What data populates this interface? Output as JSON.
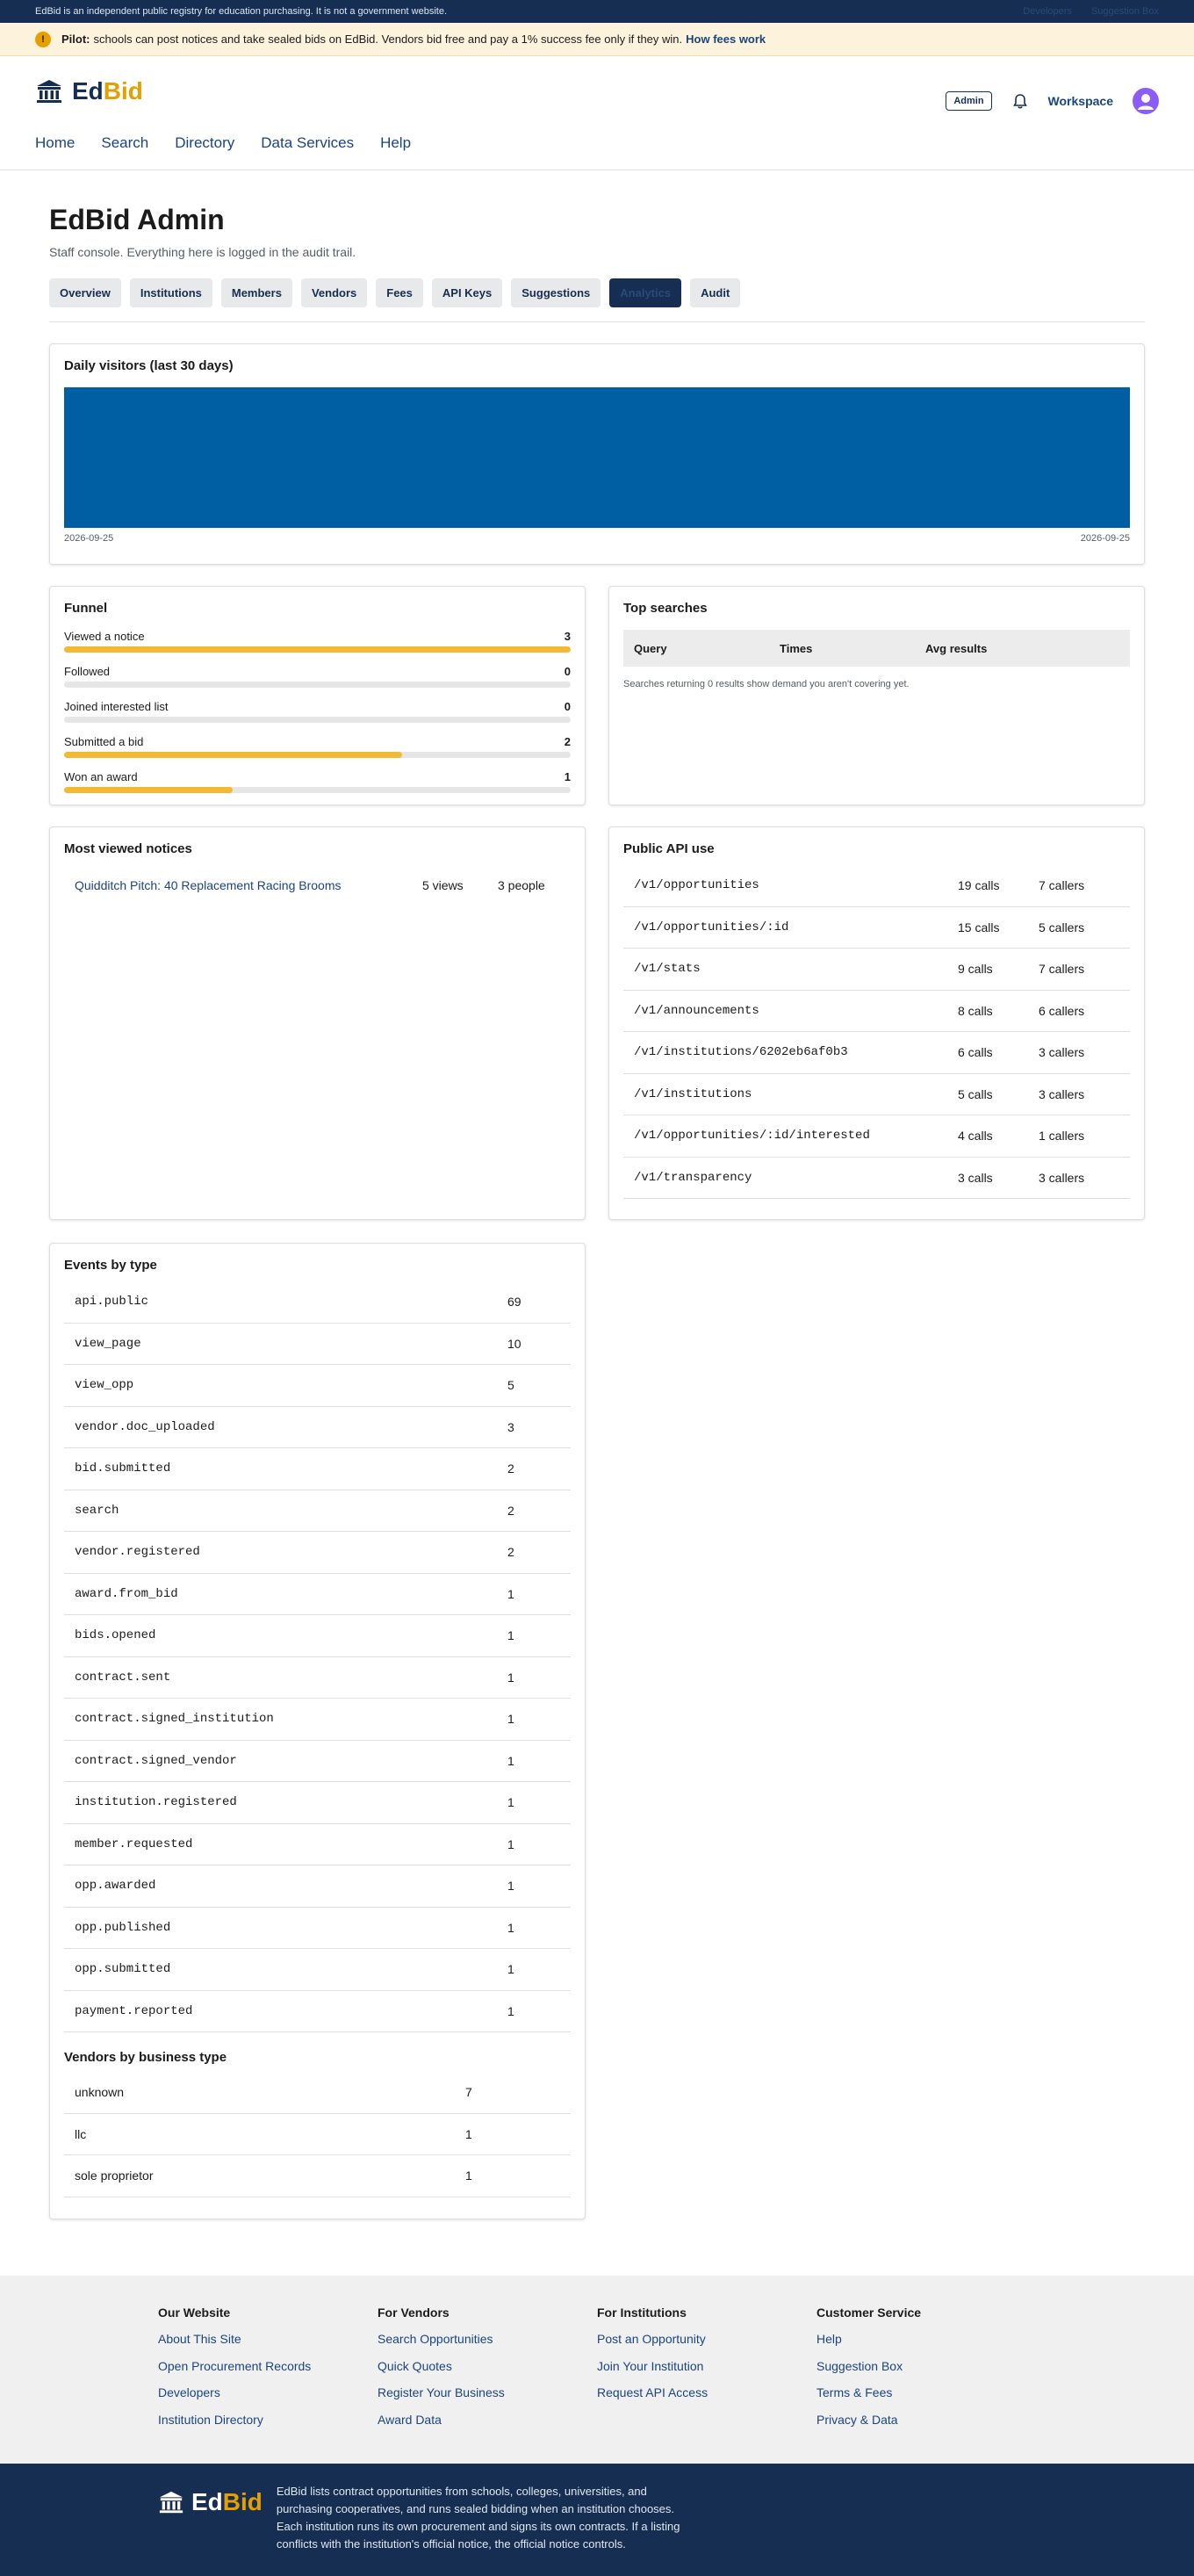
{
  "banner": {
    "notice": "EdBid is an independent public registry for education purchasing. It is not a government website.",
    "right_links": [
      "Developers",
      "Suggestion Box"
    ]
  },
  "pilot": {
    "label": "Pilot:",
    "text": "schools can post notices and take sealed bids on EdBid. Vendors bid free and pay a 1% success fee only if they win.",
    "link": "How fees work"
  },
  "header": {
    "brand_ed": "Ed",
    "brand_bid": "Bid",
    "admin_badge": "Admin",
    "workspace": "Workspace",
    "nav": [
      "Home",
      "Search",
      "Directory",
      "Data Services",
      "Help"
    ]
  },
  "admin": {
    "title": "EdBid Admin",
    "subtitle": "Staff console. Everything here is logged in the audit trail.",
    "tabs": [
      "Overview",
      "Institutions",
      "Members",
      "Vendors",
      "Fees",
      "API Keys",
      "Suggestions",
      "Analytics",
      "Audit"
    ],
    "active_tab": "Analytics"
  },
  "visitors": {
    "title": "Daily visitors (last 30 days)",
    "start_date": "2026-09-25",
    "end_date": "2026-09-25",
    "bar_color": "#005ea2"
  },
  "chart_data": {
    "type": "bar",
    "title": "Daily visitors (last 30 days)",
    "categories": [
      "2026-09-25"
    ],
    "values": [
      1
    ]
  },
  "funnel": {
    "title": "Funnel",
    "items": [
      {
        "label": "Viewed a notice",
        "count": "3",
        "fraction": 1.0
      },
      {
        "label": "Followed",
        "count": "0",
        "fraction": 0.0
      },
      {
        "label": "Joined interested list",
        "count": "0",
        "fraction": 0.0
      },
      {
        "label": "Submitted a bid",
        "count": "2",
        "fraction": 0.6667
      },
      {
        "label": "Won an award",
        "count": "1",
        "fraction": 0.3333
      }
    ]
  },
  "top_searches": {
    "title": "Top searches",
    "columns": [
      "Query",
      "Times",
      "Avg results"
    ],
    "note": "Searches returning 0 results show demand you aren't covering yet."
  },
  "most_viewed": {
    "title": "Most viewed notices",
    "rows": [
      {
        "title": "Quidditch Pitch: 40 Replacement Racing Brooms",
        "views": "5 views",
        "people": "3 people"
      }
    ]
  },
  "api_use": {
    "title": "Public API use",
    "rows": [
      {
        "path": "/v1/opportunities",
        "calls": "19 calls",
        "callers": "7 callers"
      },
      {
        "path": "/v1/opportunities/:id",
        "calls": "15 calls",
        "callers": "5 callers"
      },
      {
        "path": "/v1/stats",
        "calls": "9 calls",
        "callers": "7 callers"
      },
      {
        "path": "/v1/announcements",
        "calls": "8 calls",
        "callers": "6 callers"
      },
      {
        "path": "/v1/institutions/6202eb6af0b3",
        "calls": "6 calls",
        "callers": "3 callers"
      },
      {
        "path": "/v1/institutions",
        "calls": "5 calls",
        "callers": "3 callers"
      },
      {
        "path": "/v1/opportunities/:id/interested",
        "calls": "4 calls",
        "callers": "1 callers"
      },
      {
        "path": "/v1/transparency",
        "calls": "3 calls",
        "callers": "3 callers"
      }
    ]
  },
  "events": {
    "title": "Events by type",
    "rows": [
      {
        "type": "api.public",
        "count": "69"
      },
      {
        "type": "view_page",
        "count": "10"
      },
      {
        "type": "view_opp",
        "count": "5"
      },
      {
        "type": "vendor.doc_uploaded",
        "count": "3"
      },
      {
        "type": "bid.submitted",
        "count": "2"
      },
      {
        "type": "search",
        "count": "2"
      },
      {
        "type": "vendor.registered",
        "count": "2"
      },
      {
        "type": "award.from_bid",
        "count": "1"
      },
      {
        "type": "bids.opened",
        "count": "1"
      },
      {
        "type": "contract.sent",
        "count": "1"
      },
      {
        "type": "contract.signed_institution",
        "count": "1"
      },
      {
        "type": "contract.signed_vendor",
        "count": "1"
      },
      {
        "type": "institution.registered",
        "count": "1"
      },
      {
        "type": "member.requested",
        "count": "1"
      },
      {
        "type": "opp.awarded",
        "count": "1"
      },
      {
        "type": "opp.published",
        "count": "1"
      },
      {
        "type": "opp.submitted",
        "count": "1"
      },
      {
        "type": "payment.reported",
        "count": "1"
      }
    ]
  },
  "vendor_types": {
    "title": "Vendors by business type",
    "rows": [
      {
        "type": "unknown",
        "count": "7"
      },
      {
        "type": "llc",
        "count": "1"
      },
      {
        "type": "sole proprietor",
        "count": "1"
      }
    ]
  },
  "footer": {
    "columns": [
      {
        "title": "Our Website",
        "links": [
          "About This Site",
          "Open Procurement Records",
          "Developers",
          "Institution Directory"
        ]
      },
      {
        "title": "For Vendors",
        "links": [
          "Search Opportunities",
          "Quick Quotes",
          "Register Your Business",
          "Award Data"
        ]
      },
      {
        "title": "For Institutions",
        "links": [
          "Post an Opportunity",
          "Join Your Institution",
          "Request API Access"
        ]
      },
      {
        "title": "Customer Service",
        "links": [
          "Help",
          "Suggestion Box",
          "Terms & Fees",
          "Privacy & Data"
        ]
      }
    ],
    "about": "EdBid lists contract opportunities from schools, colleges, universities, and purchasing cooperatives, and runs sealed bidding when an institution chooses. Each institution runs its own procurement and signs its own contracts. If a listing conflicts with the institution's official notice, the official notice controls."
  }
}
